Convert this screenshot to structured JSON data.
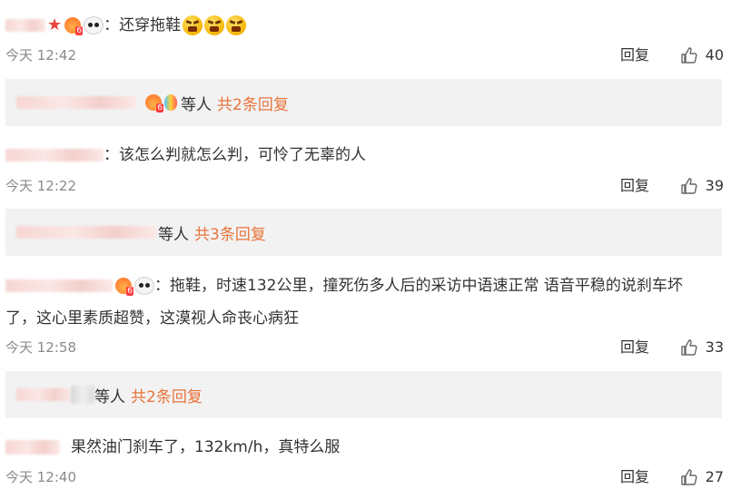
{
  "comments": [
    {
      "colon": "：",
      "text": "还穿拖鞋",
      "time": "今天 12:42",
      "reply_label": "回复",
      "likes": "40",
      "thread": {
        "people": "等人",
        "count": "共2条回复"
      }
    },
    {
      "colon": "：",
      "text": "该怎么判就怎么判，可怜了无辜的人",
      "time": "今天 12:22",
      "reply_label": "回复",
      "likes": "39",
      "thread": {
        "people": "等人",
        "count": "共3条回复"
      }
    },
    {
      "colon": "：",
      "text": "拖鞋，时速132公里，撞死伤多人后的采访中语速正常  语音平稳的说刹车坏",
      "text_line2": "了，这心里素质超赞，这漠视人命丧心病狂",
      "time": "今天 12:58",
      "reply_label": "回复",
      "likes": "33",
      "thread": {
        "people": "等人",
        "count": "共2条回复"
      }
    },
    {
      "text": "果然油门刹车了，132km/h，真特么服",
      "time": "今天 12:40",
      "reply_label": "回复",
      "likes": "27"
    }
  ],
  "icons": {
    "like": "thumbs-up-icon",
    "emoji": "angry-face-icon",
    "star": "red-star-icon",
    "crown": "vip-crown-icon",
    "panda": "panda-icon",
    "balloon": "balloon-icon"
  },
  "colors": {
    "reply_count": "#e8743b",
    "reply_box_bg": "#f2f2f2",
    "meta_text": "#8a8a8a"
  }
}
